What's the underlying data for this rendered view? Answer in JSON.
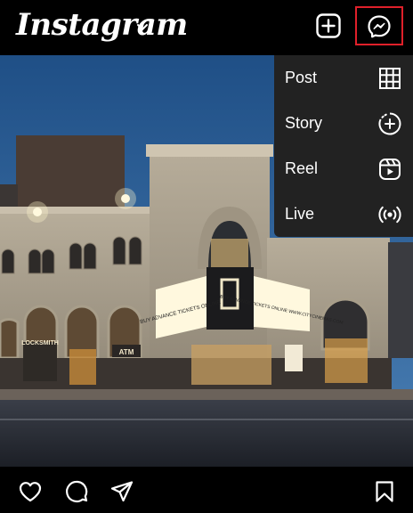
{
  "app": {
    "title": "Instagram"
  },
  "header": {
    "logo_text": "Instagram",
    "account_switch_icon": "chevron-down-icon",
    "new_post_icon": "plus-square-icon",
    "messenger_icon": "messenger-icon",
    "highlight_color": "#e0202a"
  },
  "create_menu": {
    "items": [
      {
        "label": "Post",
        "icon": "grid-icon"
      },
      {
        "label": "Story",
        "icon": "story-plus-icon"
      },
      {
        "label": "Reel",
        "icon": "reel-icon"
      },
      {
        "label": "Live",
        "icon": "live-broadcast-icon"
      }
    ]
  },
  "photo": {
    "signs": {
      "marquee_left": "BUY ADVANCE TICKETS ONLINE",
      "marquee_right": "BUY ADVANCE TICKETS ONLINE WWW.CITYCINEMAS.COM",
      "store": "LOCKSMITH",
      "atm": "ATM"
    }
  },
  "bottom_nav": {
    "icons": [
      "heart-icon",
      "comment-icon",
      "share-icon",
      "bookmark-icon"
    ]
  }
}
